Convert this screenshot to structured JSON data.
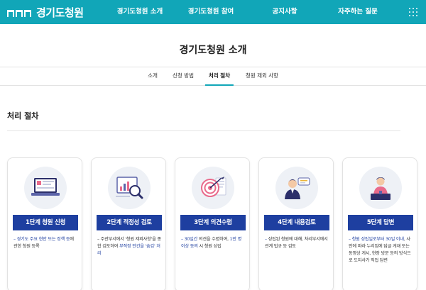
{
  "header": {
    "logo_text": "경기도청원",
    "nav": [
      {
        "label": "경기도청원 소개"
      },
      {
        "label": "경기도청원 참여"
      },
      {
        "label": "공지사항"
      },
      {
        "label": "자주하는 질문"
      }
    ],
    "menu_icon": "grid-menu-icon"
  },
  "page": {
    "title": "경기도청원 소개"
  },
  "subtabs": [
    {
      "label": "소개",
      "active": false
    },
    {
      "label": "신청 방법",
      "active": false
    },
    {
      "label": "처리 절차",
      "active": true
    },
    {
      "label": "청원 제외 사항",
      "active": false
    }
  ],
  "section": {
    "heading": "처리 절차"
  },
  "steps": [
    {
      "label": "1단계 청원 신청",
      "icon": "laptop-icon",
      "desc_dash": "– ",
      "desc_hl": "경기도 주요 현안 또는 정책 등",
      "desc_rest": "에 관한 청원 등록"
    },
    {
      "label": "2단계 적정성 검토",
      "icon": "magnifier-chart-icon",
      "desc_a": "– 주관부서에서 '청원 제외사항'을 종합 검토하여 ",
      "desc_hl": "부적정 안건을 '숨김' 처리",
      "desc_b": ""
    },
    {
      "label": "3단계 의견수렴",
      "icon": "target-icon",
      "desc_dash": "– ",
      "desc_hl1": "30일간",
      "desc_mid": " 의견을 수렴하여, ",
      "desc_hl2": "1만 명 이상 동의",
      "desc_rest": " 시 청원 성립"
    },
    {
      "label": "4단계 내용검토",
      "icon": "speaker-icon",
      "desc_dash": "– ",
      "desc_text": "성립된 청원에 대해, 처리부서에서 관계 법규 등 검토"
    },
    {
      "label": "5단계 답변",
      "icon": "official-icon",
      "desc_dash": "– ",
      "desc_hl": "청원 성립일로부터 30일 이내",
      "desc_rest": ", 사안에 따라 누리집에 답글 게재 또는 동영상 게시, 현장 방문 등의 방식으로 도지사가 직접 답변"
    }
  ],
  "colors": {
    "header_bg": "#11a6b8",
    "step_label_bg": "#1e3fa0",
    "highlight_text": "#1e3fa0"
  }
}
